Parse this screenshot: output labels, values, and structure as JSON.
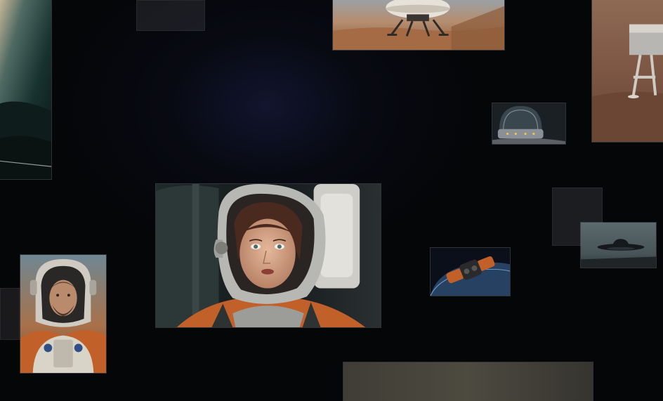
{
  "gallery": {
    "tiles": [
      {
        "subject": "dark-mountain-horizon"
      },
      {
        "subject": "lunar-lander-on-desert"
      },
      {
        "subject": "lander-leg-on-dunes"
      },
      {
        "subject": "glass-dome-spacecraft"
      },
      {
        "subject": "woman-astronaut-in-cockpit"
      },
      {
        "subject": "man-astronaut-portrait"
      },
      {
        "subject": "space-station-module-over-planet"
      },
      {
        "subject": "flying-saucer-over-plain"
      },
      {
        "subject": "dusty-landscape-strip"
      }
    ]
  },
  "colors": {
    "background": "#050608",
    "glow": "#12163a",
    "suit_orange": "#c2602a",
    "desert": "#a8714a"
  }
}
